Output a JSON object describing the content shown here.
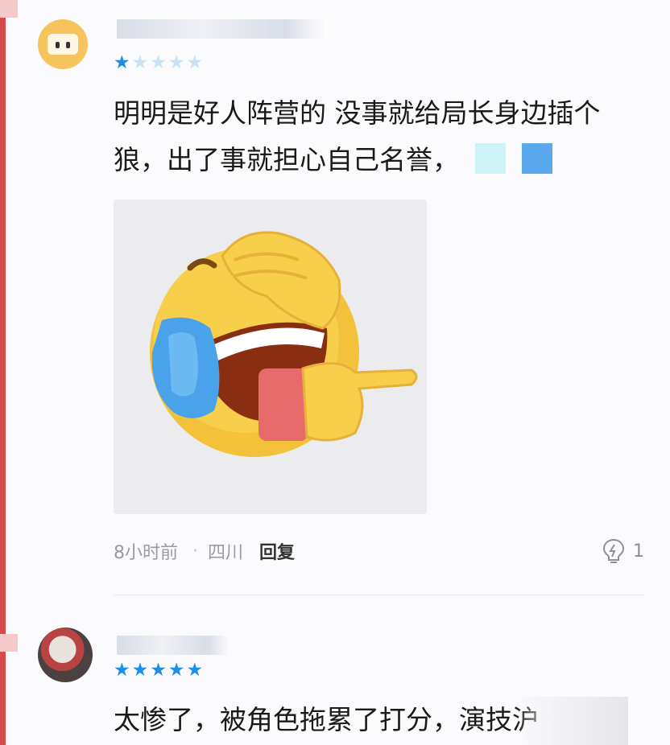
{
  "comments": [
    {
      "rating": {
        "filled": 1,
        "total": 5
      },
      "text_line1": "明明是好人阵营的 没事就给局长身边插个",
      "text_line2": "狼，出了事就担心自己名誉，",
      "meta": {
        "time": "8小时前",
        "separator": "·",
        "location": "四川",
        "reply_label": "回复"
      },
      "likes": "1"
    },
    {
      "rating": {
        "filled": 5,
        "total": 5
      },
      "text": "太惨了，被角色拖累了打分，演技沪"
    }
  ],
  "colors": {
    "star_filled": "#1f8fe6",
    "star_empty": "#c8e3f7",
    "edge_accent": "#d94b4b"
  },
  "icons": {
    "like": "lightbulb-icon",
    "star": "star-icon"
  }
}
